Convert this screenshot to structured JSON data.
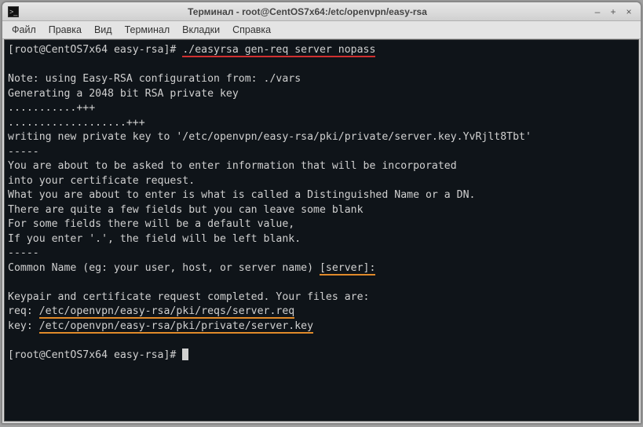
{
  "window": {
    "title": "Терминал - root@CentOS7x64:/etc/openvpn/easy-rsa"
  },
  "window_controls": {
    "minimize": "–",
    "maximize": "+",
    "close": "×"
  },
  "menu": {
    "file": "Файл",
    "edit": "Правка",
    "view": "Вид",
    "terminal": "Терминал",
    "tabs": "Вкладки",
    "help": "Справка"
  },
  "term": {
    "prompt1": "[root@CentOS7x64 easy-rsa]# ",
    "command": "./easyrsa gen-req server nopass",
    "blank": "",
    "note": "Note: using Easy-RSA configuration from: ./vars",
    "gen": "Generating a 2048 bit RSA private key",
    "dots1": "...........+++",
    "dots2": "...................+++",
    "writing": "writing new private key to '/etc/openvpn/easy-rsa/pki/private/server.key.YvRjlt8Tbt'",
    "sep1": "-----",
    "about1": "You are about to be asked to enter information that will be incorporated",
    "about2": "into your certificate request.",
    "about3": "What you are about to enter is what is called a Distinguished Name or a DN.",
    "about4": "There are quite a few fields but you can leave some blank",
    "about5": "For some fields there will be a default value,",
    "about6": "If you enter '.', the field will be left blank.",
    "sep2": "-----",
    "cn_label": "Common Name (eg: your user, host, or server name) ",
    "cn_input": "[server]:",
    "completed": "Keypair and certificate request completed. Your files are:",
    "req_label": "req: ",
    "req_path": "/etc/openvpn/easy-rsa/pki/reqs/server.req",
    "key_label": "key: ",
    "key_path": "/etc/openvpn/easy-rsa/pki/private/server.key",
    "prompt2": "[root@CentOS7x64 easy-rsa]# "
  }
}
